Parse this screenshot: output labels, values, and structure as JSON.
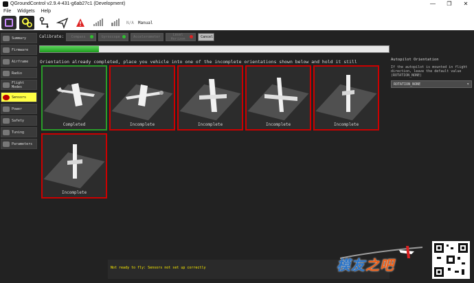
{
  "window": {
    "title": "QGroundControl v2.9.4-431-g6ab27c1 (Development)",
    "minimize": "—",
    "maximize": "❐",
    "close": "✕"
  },
  "menu": {
    "items": [
      "File",
      "Widgets",
      "Help"
    ]
  },
  "toolbar": {
    "na_label": "N/A",
    "mode_label": "Manual",
    "signal_na": "N/A"
  },
  "sidebar": {
    "items": [
      {
        "label": "Summary",
        "active": false
      },
      {
        "label": "Firmware",
        "active": false
      },
      {
        "label": "Airframe",
        "active": false
      },
      {
        "label": "Radio",
        "active": false
      },
      {
        "label": "Flight Modes",
        "active": false
      },
      {
        "label": "Sensors",
        "active": true
      },
      {
        "label": "Power",
        "active": false
      },
      {
        "label": "Safety",
        "active": false
      },
      {
        "label": "Tuning",
        "active": false
      },
      {
        "label": "Parameters",
        "active": false
      }
    ]
  },
  "calibrate": {
    "label": "Calibrate:",
    "buttons": [
      {
        "label": "Compass",
        "status_color": "#2fbf2f"
      },
      {
        "label": "Gyroscope",
        "status_color": "#2fbf2f"
      },
      {
        "label": "Accelerometer",
        "status_color": "#d22"
      },
      {
        "label": "Level Horizon",
        "status_color": "#d22"
      }
    ],
    "cancel_label": "Cancel"
  },
  "progress": {
    "value": 0.17
  },
  "instruction": "Orientation already completed, place you vehicle into one of the incomplete orientations shown below and hold it still",
  "orientations": [
    {
      "caption": "Completed",
      "state": "completed"
    },
    {
      "caption": "Incomplete",
      "state": "incomplete"
    },
    {
      "caption": "Incomplete",
      "state": "incomplete"
    },
    {
      "caption": "Incomplete",
      "state": "incomplete"
    },
    {
      "caption": "Incomplete",
      "state": "incomplete"
    },
    {
      "caption": "Incomplete",
      "state": "incomplete"
    }
  ],
  "status": {
    "message": "Not ready to fly: Sensors not set up correctly"
  },
  "right_panel": {
    "heading": "Autopilot Orientation",
    "description": "If the autopilot is mounted in flight direction, leave the default value (ROTATION_NONE)",
    "selected": "ROTATION_NONE"
  },
  "watermark": {
    "text_blue": "模友",
    "text_orange": "之吧"
  },
  "colors": {
    "completed_border": "#2a9d2a",
    "incomplete_border": "#cc0000",
    "active_sidebar": "#ffff44",
    "status_text": "#ffef00"
  }
}
